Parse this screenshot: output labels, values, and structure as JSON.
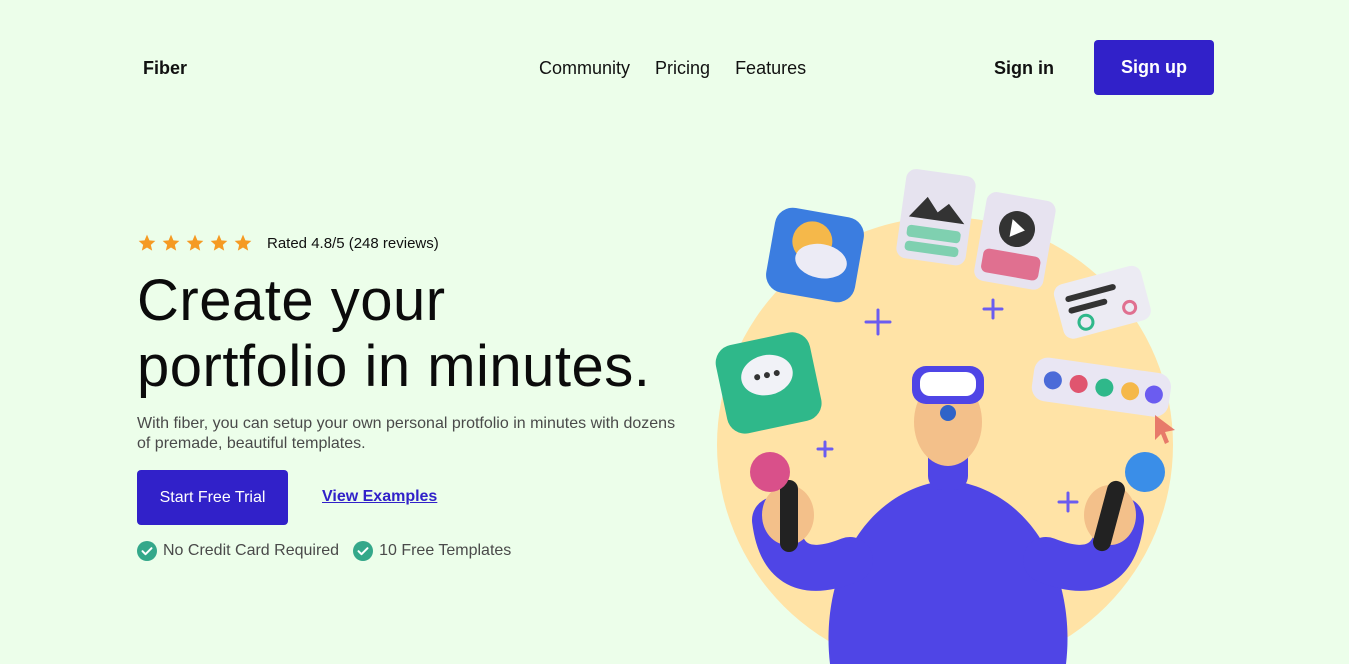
{
  "header": {
    "logo": "Fiber",
    "nav": [
      "Community",
      "Pricing",
      "Features"
    ],
    "sign_in": "Sign in",
    "sign_up": "Sign up"
  },
  "hero": {
    "rating": {
      "stars": 5,
      "text": "Rated 4.8/5 (248 reviews)"
    },
    "headline_line1": "Create your",
    "headline_line2": "portfolio in minutes.",
    "subtitle": "With fiber, you can setup your own personal protfolio in minutes with dozens of premade, beautiful templates.",
    "primary_cta": "Start Free Trial",
    "secondary_cta": "View Examples",
    "checks": [
      "No Credit Card Required",
      "10 Free Templates"
    ]
  },
  "colors": {
    "background": "#ecfeea",
    "primary": "#3121c9",
    "star": "#f59a23",
    "check": "#34a88a",
    "circle": "#ffe3a6"
  }
}
